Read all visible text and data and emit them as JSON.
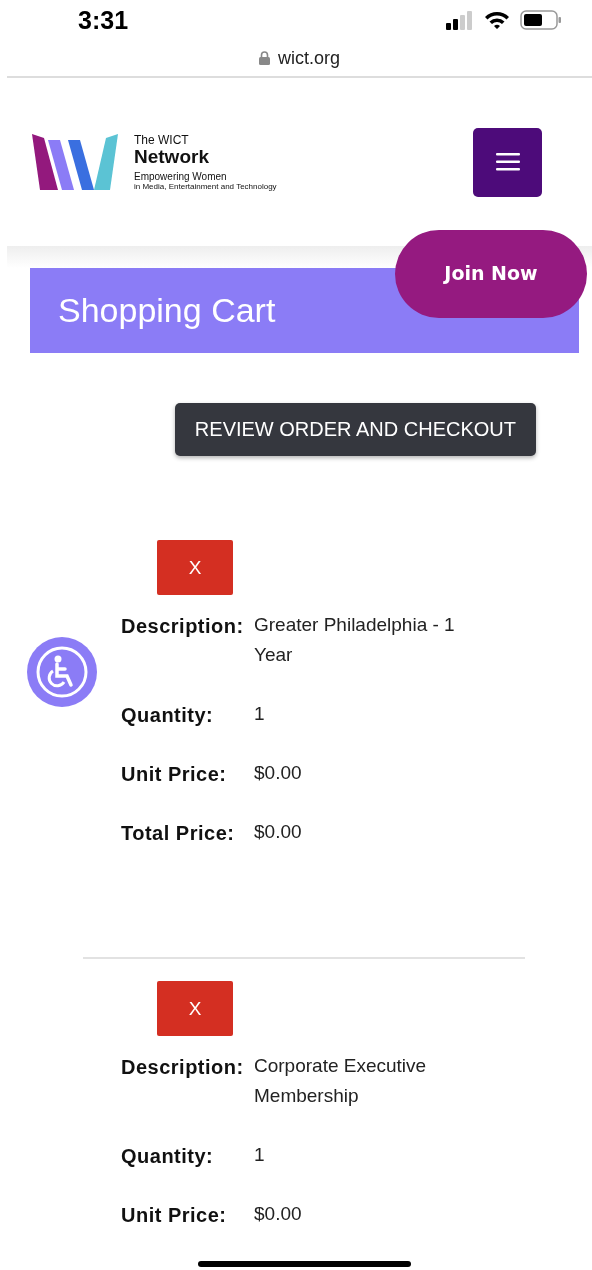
{
  "status_bar": {
    "time": "3:31"
  },
  "address_bar": {
    "url": "wict.org"
  },
  "header": {
    "logo": {
      "line_1": "The WICT",
      "line_2": "Network",
      "line_3": "Empowering Women",
      "line_4": "in Media, Entertainment and Technology"
    }
  },
  "join_button": "Join Now",
  "page_title": "Shopping Cart",
  "checkout_button": "REVIEW ORDER AND CHECKOUT",
  "cart_items": [
    {
      "remove_label": "X",
      "fields": [
        {
          "label": "Description:",
          "value": "Greater Philadelphia - 1 Year"
        },
        {
          "label": "Quantity:",
          "value": "1"
        },
        {
          "label": "Unit Price:",
          "value": "$0.00"
        },
        {
          "label": "Total Price:",
          "value": "$0.00"
        }
      ]
    },
    {
      "remove_label": "X",
      "fields": [
        {
          "label": "Description:",
          "value": "Corporate Executive Membership"
        },
        {
          "label": "Quantity:",
          "value": "1"
        },
        {
          "label": "Unit Price:",
          "value": "$0.00"
        }
      ]
    }
  ]
}
